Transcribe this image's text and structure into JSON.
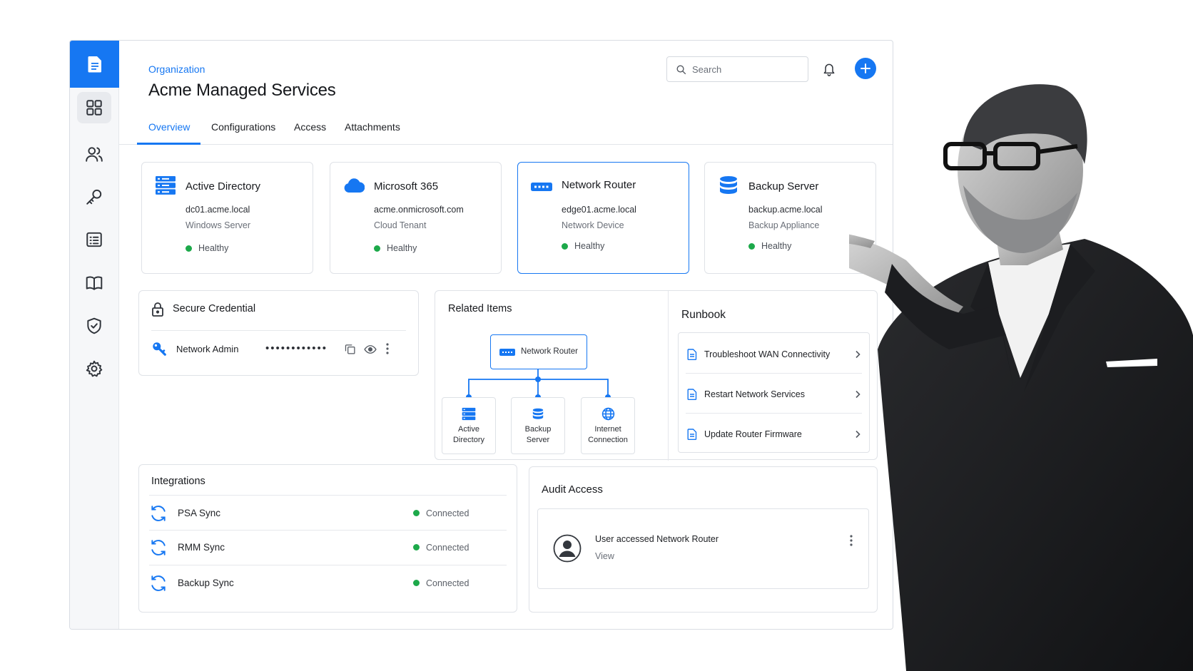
{
  "header": {
    "eyebrow": "Organization",
    "title": "Acme Managed Services",
    "search_placeholder": "Search"
  },
  "sidebar": {
    "items": [
      {
        "name": "dashboard",
        "icon": "grid-icon",
        "active": true
      },
      {
        "name": "contacts",
        "icon": "users-icon"
      },
      {
        "name": "passwords",
        "icon": "key-icon"
      },
      {
        "name": "checklists",
        "icon": "list-icon"
      },
      {
        "name": "documentation",
        "icon": "book-icon"
      },
      {
        "name": "security",
        "icon": "shield-check-icon"
      },
      {
        "name": "settings",
        "icon": "gear-icon"
      }
    ]
  },
  "tabs": [
    "Overview",
    "Configurations",
    "Access",
    "Attachments"
  ],
  "assets": [
    {
      "title": "Active Directory",
      "host": "dc01.acme.local",
      "type": "Windows Server",
      "status": "Healthy",
      "icon": "server-icon"
    },
    {
      "title": "Microsoft 365",
      "host": "acme.onmicrosoft.com",
      "type": "Cloud Tenant",
      "status": "Healthy",
      "icon": "cloud-icon"
    },
    {
      "title": "Network Router",
      "host": "edge01.acme.local",
      "type": "Network Device",
      "status": "Healthy",
      "icon": "router-icon"
    },
    {
      "title": "Backup Server",
      "host": "backup.acme.local",
      "type": "Backup Appliance",
      "status": "Healthy",
      "icon": "database-icon"
    }
  ],
  "credential": {
    "title": "Secure Credential",
    "name": "Network Admin",
    "masked": "••••••••••••"
  },
  "related": {
    "title": "Related Items",
    "root": "Network Router",
    "children": [
      {
        "line1": "Active",
        "line2": "Directory"
      },
      {
        "line1": "Backup",
        "line2": "Server"
      },
      {
        "line1": "Internet",
        "line2": "Connection"
      }
    ]
  },
  "runbook": {
    "title": "Runbook",
    "items": [
      "Troubleshoot WAN Connectivity",
      "Restart Network Services",
      "Update Router Firmware"
    ]
  },
  "integrations": {
    "title": "Integrations",
    "items": [
      {
        "name": "PSA Sync",
        "status": "Connected"
      },
      {
        "name": "RMM Sync",
        "status": "Connected"
      },
      {
        "name": "Backup Sync",
        "status": "Connected"
      }
    ]
  },
  "audit": {
    "title": "Audit Access",
    "event": "User accessed Network Router",
    "action": "View"
  },
  "colors": {
    "accent": "#1677f2",
    "healthy": "#1da94a"
  }
}
